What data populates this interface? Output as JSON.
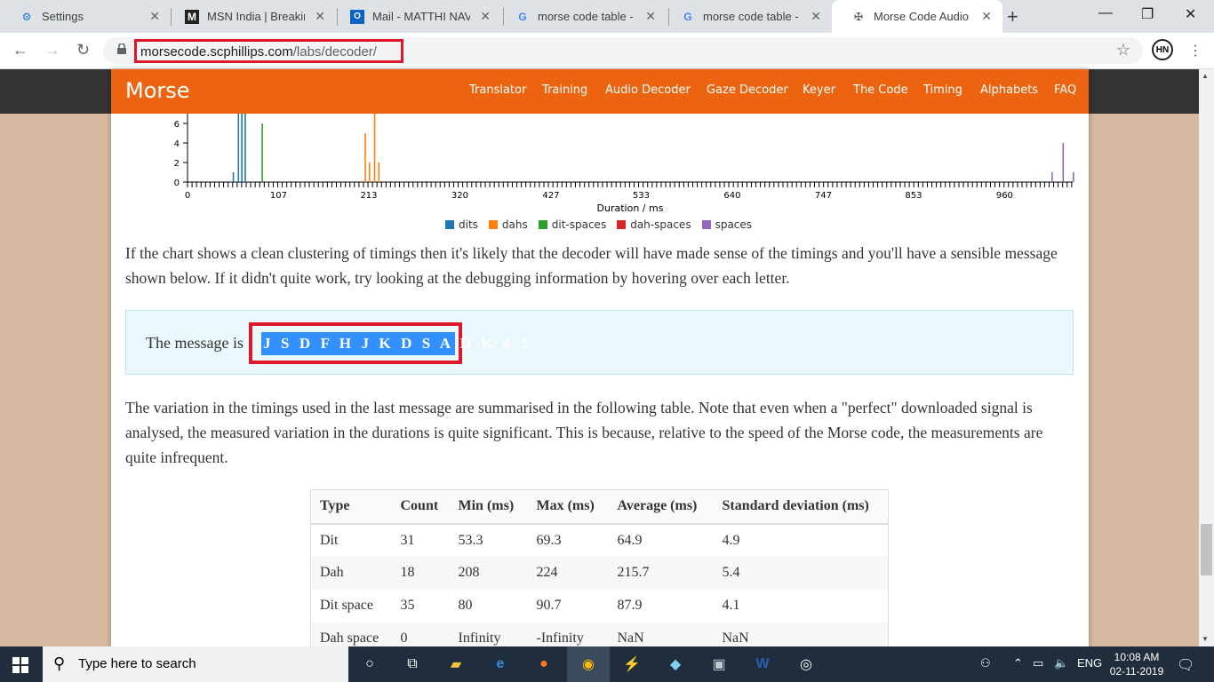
{
  "browser": {
    "tabs": [
      {
        "title": "Settings",
        "icon": "gear-icon"
      },
      {
        "title": "MSN India | Breakin",
        "icon": "msn-icon"
      },
      {
        "title": "Mail - MATTHI NAV",
        "icon": "outlook-icon"
      },
      {
        "title": "morse code table -",
        "icon": "google-icon"
      },
      {
        "title": "morse code table -",
        "icon": "google-icon"
      },
      {
        "title": "Morse Code Audio",
        "icon": "morse-site-icon"
      }
    ],
    "url_host": "morsecode.scphillips.com",
    "url_path": "/labs/decoder/"
  },
  "site": {
    "brand": "Morse",
    "nav": [
      "Translator",
      "Training",
      "Audio Decoder",
      "Gaze Decoder",
      "Keyer",
      "The Code",
      "Timing",
      "Alphabets",
      "FAQ"
    ]
  },
  "chart_data": {
    "type": "bar",
    "xlabel": "Duration / ms",
    "ylabel": "",
    "xlim": [
      0,
      1040
    ],
    "ylim": [
      0,
      8
    ],
    "x_ticks": [
      0,
      107,
      213,
      320,
      427,
      533,
      640,
      747,
      853,
      960
    ],
    "y_ticks": [
      0,
      2,
      4,
      6
    ],
    "series": [
      {
        "name": "dits",
        "color": "#1f77b4",
        "points": [
          [
            53,
            1
          ],
          [
            59,
            9
          ],
          [
            63,
            9
          ],
          [
            67,
            9
          ]
        ]
      },
      {
        "name": "dahs",
        "color": "#ff7f0e",
        "points": [
          [
            208,
            5
          ],
          [
            213,
            2
          ],
          [
            219,
            9
          ],
          [
            224,
            2
          ]
        ]
      },
      {
        "name": "dit-spaces",
        "color": "#2ca02c",
        "points": [
          [
            87,
            6
          ]
        ]
      },
      {
        "name": "dah-spaces",
        "color": "#d62728",
        "points": []
      },
      {
        "name": "spaces",
        "color": "#9467bd",
        "points": [
          [
            1015,
            1
          ],
          [
            1028,
            4
          ],
          [
            1040,
            1
          ]
        ]
      }
    ]
  },
  "text": {
    "para1": "If the chart shows a clean clustering of timings then it's likely that the decoder will have made sense of the timings and you'll have a sensible message shown below. If it didn't quite work, try looking at the debugging information by hovering over each letter.",
    "message_label": "The message is",
    "message": "J S D F H J K D S A D K 4 3",
    "para2": "The variation in the timings used in the last message are summarised in the following table. Note that even when a \"perfect\" downloaded signal is analysed, the measured variation in the durations is quite significant. This is because, relative to the speed of the Morse code, the measurements are quite infrequent."
  },
  "table": {
    "headers": [
      "Type",
      "Count",
      "Min (ms)",
      "Max (ms)",
      "Average (ms)",
      "Standard deviation (ms)"
    ],
    "rows": [
      [
        "Dit",
        "31",
        "53.3",
        "69.3",
        "64.9",
        "4.9"
      ],
      [
        "Dah",
        "18",
        "208",
        "224",
        "215.7",
        "5.4"
      ],
      [
        "Dit space",
        "35",
        "80",
        "90.7",
        "87.9",
        "4.1"
      ],
      [
        "Dah space",
        "0",
        "Infinity",
        "-Infinity",
        "NaN",
        "NaN"
      ]
    ]
  },
  "taskbar": {
    "search_placeholder": "Type here to search",
    "lang": "ENG",
    "time": "10:08 AM",
    "date": "02-11-2019"
  }
}
